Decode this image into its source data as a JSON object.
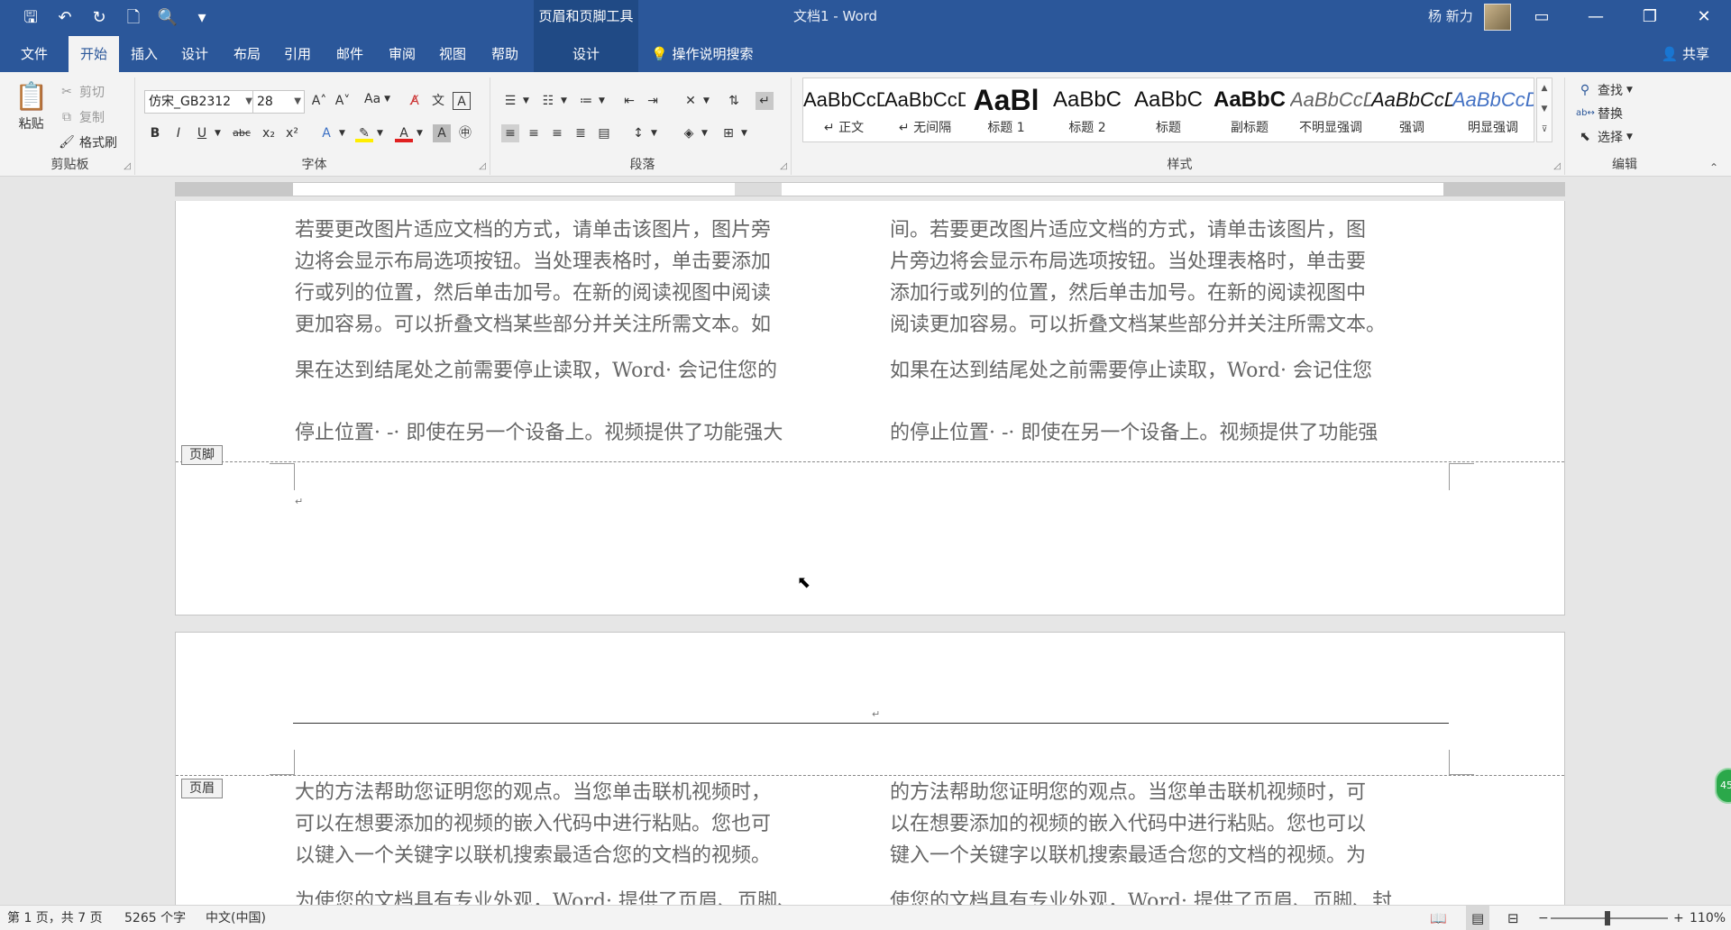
{
  "titlebar": {
    "contextual_tool": "页眉和页脚工具",
    "document_title": "文档1  -  Word",
    "user_name": "杨 新力"
  },
  "tabs": [
    "文件",
    "开始",
    "插入",
    "设计",
    "布局",
    "引用",
    "邮件",
    "审阅",
    "视图",
    "帮助"
  ],
  "active_tab": "开始",
  "context_tab": "设计",
  "tell_me": "操作说明搜索",
  "share": "共享",
  "clipboard": {
    "paste": "粘贴",
    "cut": "剪切",
    "copy": "复制",
    "format_painter": "格式刷",
    "label": "剪贴板"
  },
  "font": {
    "name": "仿宋_GB2312",
    "size": "28",
    "case": "Aa",
    "label": "字体"
  },
  "paragraph": {
    "label": "段落"
  },
  "styles": {
    "label": "样式",
    "items": [
      {
        "preview": "AaBbCcD",
        "name": "↵ 正文"
      },
      {
        "preview": "AaBbCcD",
        "name": "↵ 无间隔"
      },
      {
        "preview": "AaBl",
        "name": "标题 1"
      },
      {
        "preview": "AaBbC",
        "name": "标题 2"
      },
      {
        "preview": "AaBbC",
        "name": "标题"
      },
      {
        "preview": "AaBbC",
        "name": "副标题"
      },
      {
        "preview": "AaBbCcD",
        "name": "不明显强调"
      },
      {
        "preview": "AaBbCcD",
        "name": "强调"
      },
      {
        "preview": "AaBbCcD",
        "name": "明显强调"
      }
    ]
  },
  "editing": {
    "find": "查找",
    "replace": "替换",
    "select": "选择",
    "label": "编辑"
  },
  "page1": {
    "left_col": [
      "若要更改图片适应文档的方式，请单击该图片，图片旁",
      "边将会显示布局选项按钮。当处理表格时，单击要添加",
      "行或列的位置，然后单击加号。在新的阅读视图中阅读",
      "更加容易。可以折叠文档某些部分并关注所需文本。如",
      "果在达到结尾处之前需要停止读取，Word· 会记住您的",
      "停止位置· -· 即使在另一个设备上。视频提供了功能强大"
    ],
    "right_col": [
      "间。若要更改图片适应文档的方式，请单击该图片，图",
      "片旁边将会显示布局选项按钮。当处理表格时，单击要",
      "添加行或列的位置，然后单击加号。在新的阅读视图中",
      "阅读更加容易。可以折叠文档某些部分并关注所需文本。",
      "如果在达到结尾处之前需要停止读取，Word· 会记住您",
      "的停止位置· -· 即使在另一个设备上。视频提供了功能强"
    ],
    "footer_tag": "页脚"
  },
  "page2": {
    "header_tag": "页眉",
    "left_col": [
      "大的方法帮助您证明您的观点。当您单击联机视频时，",
      "可以在想要添加的视频的嵌入代码中进行粘贴。您也可",
      "以键入一个关键字以联机搜索最适合您的文档的视频。",
      "为使您的文档具有专业外观，Word· 提供了页眉、页脚、"
    ],
    "right_col": [
      "的方法帮助您证明您的观点。当您单击联机视频时，可",
      "以在想要添加的视频的嵌入代码中进行粘贴。您也可以",
      "键入一个关键字以联机搜索最适合您的文档的视频。为",
      "使您的文档具有专业外观，Word· 提供了页眉、页脚、封"
    ]
  },
  "statusbar": {
    "page": "第 1 页，共 7 页",
    "words": "5265 个字",
    "language": "中文(中国)",
    "zoom": "110%"
  },
  "badge": "45",
  "colors": {
    "accent": "#2b579a",
    "page": "#ffffff",
    "canvas": "#e6e6e6"
  }
}
